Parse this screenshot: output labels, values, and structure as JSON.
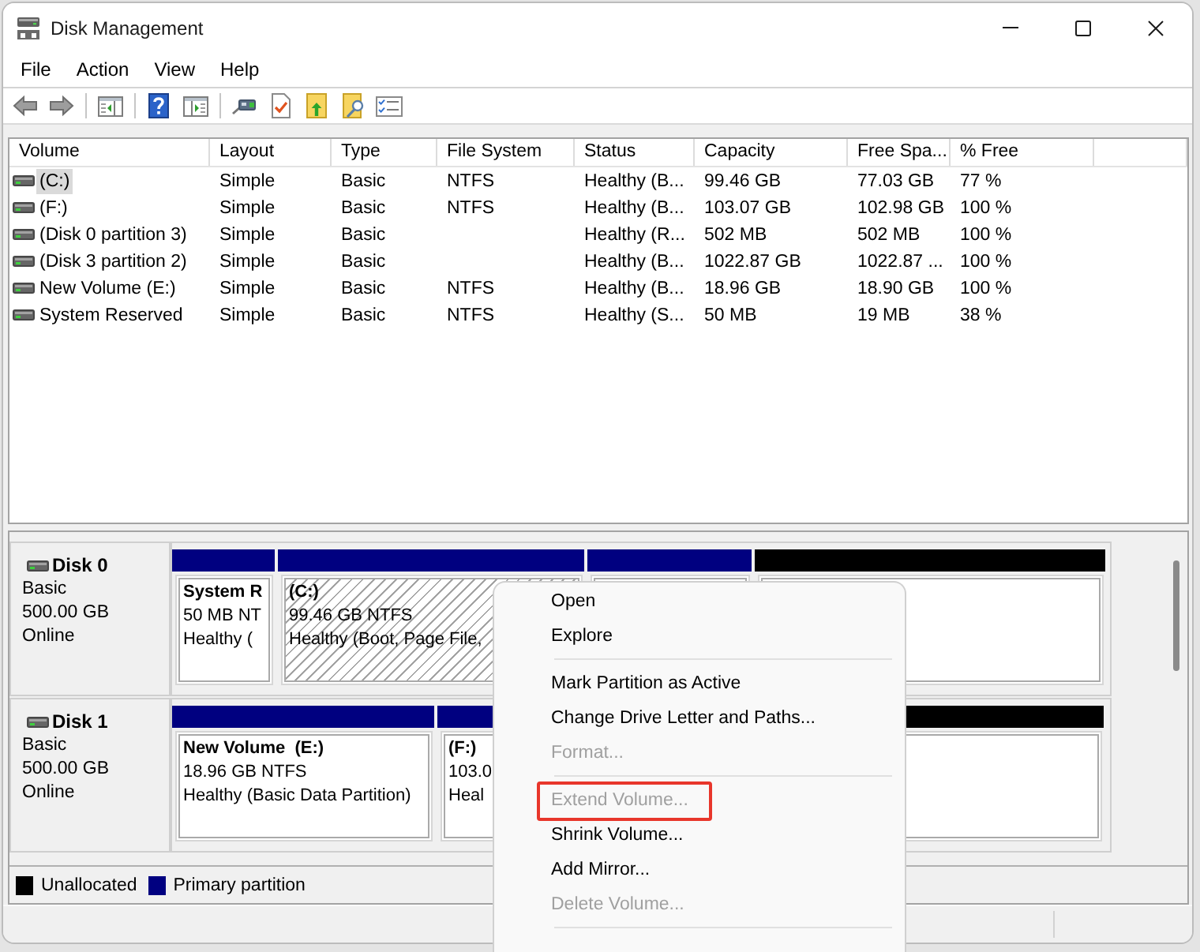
{
  "window": {
    "title": "Disk Management"
  },
  "menu_bar": [
    "File",
    "Action",
    "View",
    "Help"
  ],
  "volume_list": {
    "columns": [
      "Volume",
      "Layout",
      "Type",
      "File System",
      "Status",
      "Capacity",
      "Free Spa...",
      "% Free"
    ],
    "rows": [
      {
        "selected": true,
        "cells": [
          "(C:)",
          "Simple",
          "Basic",
          "NTFS",
          "Healthy (B...",
          "99.46 GB",
          "77.03 GB",
          "77 %"
        ]
      },
      {
        "selected": false,
        "cells": [
          "(F:)",
          "Simple",
          "Basic",
          "NTFS",
          "Healthy (B...",
          "103.07 GB",
          "102.98 GB",
          "100 %"
        ]
      },
      {
        "selected": false,
        "cells": [
          "(Disk 0 partition 3)",
          "Simple",
          "Basic",
          null,
          "Healthy (R...",
          "502 MB",
          "502 MB",
          "100 %"
        ]
      },
      {
        "selected": false,
        "cells": [
          "(Disk 3 partition 2)",
          "Simple",
          "Basic",
          null,
          "Healthy (B...",
          "1022.87 GB",
          "1022.87 ...",
          "100 %"
        ]
      },
      {
        "selected": false,
        "cells": [
          "New Volume (E:)",
          "Simple",
          "Basic",
          "NTFS",
          "Healthy (B...",
          "18.96 GB",
          "18.90 GB",
          "100 %"
        ]
      },
      {
        "selected": false,
        "cells": [
          "System Reserved",
          "Simple",
          "Basic",
          "NTFS",
          "Healthy (S...",
          "50 MB",
          "19 MB",
          "38 %"
        ]
      }
    ]
  },
  "disk_map": {
    "disks": [
      {
        "name": "Disk 0",
        "type": "Basic",
        "size": "500.00 GB",
        "status": "Online",
        "partitions": [
          {
            "kind": "primary",
            "selected": false,
            "label": "System R",
            "details": "50 MB NT",
            "status": "Healthy ("
          },
          {
            "kind": "primary",
            "selected": true,
            "label": "(C:)",
            "details": "99.46 GB NTFS",
            "status": "Healthy (Boot, Page File,"
          },
          {
            "kind": "primary",
            "selected": false
          },
          {
            "kind": "unallocated",
            "selected": false
          }
        ]
      },
      {
        "name": "Disk 1",
        "type": "Basic",
        "size": "500.00 GB",
        "status": "Online",
        "partitions": [
          {
            "kind": "primary",
            "selected": false,
            "label": "New Volume  (E:)",
            "details": "18.96 GB NTFS",
            "status": "Healthy (Basic Data Partition)"
          },
          {
            "kind": "primary",
            "selected": false,
            "label": "(F:)",
            "details": "103.0",
            "status": "Heal"
          },
          {
            "kind": "unallocated",
            "selected": false
          }
        ]
      }
    ]
  },
  "legend": [
    {
      "kind": "unallocated",
      "label": "Unallocated",
      "color": "#000000"
    },
    {
      "kind": "primary",
      "label": "Primary partition",
      "color": "#000080"
    }
  ],
  "context_menu": {
    "items": [
      {
        "kind": "item",
        "label": "Open",
        "disabled": false,
        "highlighted": false
      },
      {
        "kind": "item",
        "label": "Explore",
        "disabled": false,
        "highlighted": false
      },
      {
        "kind": "separator"
      },
      {
        "kind": "item",
        "label": "Mark Partition as Active",
        "disabled": false,
        "highlighted": false
      },
      {
        "kind": "item",
        "label": "Change Drive Letter and Paths...",
        "disabled": false,
        "highlighted": false
      },
      {
        "kind": "item",
        "label": "Format...",
        "disabled": true,
        "highlighted": false
      },
      {
        "kind": "separator"
      },
      {
        "kind": "item",
        "label": "Extend Volume...",
        "disabled": true,
        "highlighted": true
      },
      {
        "kind": "item",
        "label": "Shrink Volume...",
        "disabled": false,
        "highlighted": false
      },
      {
        "kind": "item",
        "label": "Add Mirror...",
        "disabled": false,
        "highlighted": false
      },
      {
        "kind": "item",
        "label": "Delete Volume...",
        "disabled": true,
        "highlighted": false
      },
      {
        "kind": "separator"
      }
    ]
  }
}
